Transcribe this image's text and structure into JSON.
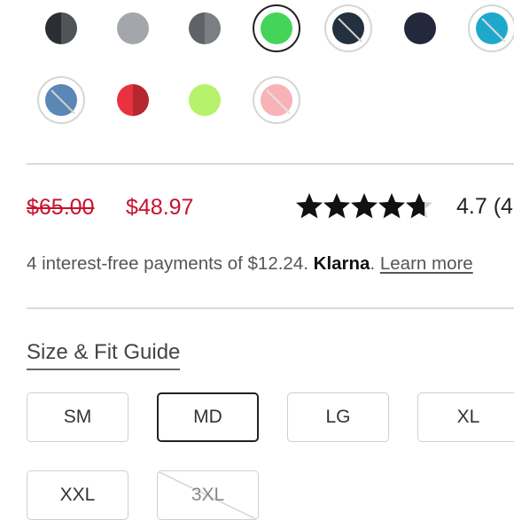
{
  "colors": {
    "price_red": "#c8102e",
    "star_fill": "#111111",
    "swatches_row1": [
      "#2b2f33",
      "#a3a7ab",
      "#5f6368",
      "#45d45a",
      "#22303f",
      "#23283d",
      "#1ea8cc"
    ],
    "swatches_row2": [
      "#5a87b5",
      "#e8323f",
      "#b6f26b",
      "#f7b3b6"
    ]
  },
  "swatch_states": {
    "selected_index": 3,
    "row1_unavailable": [
      4,
      6
    ],
    "row2_unavailable": [
      0,
      3
    ]
  },
  "price": {
    "original": "$65.00",
    "sale": "$48.97"
  },
  "rating": {
    "stars": 4.7,
    "text": "4.7 (4"
  },
  "payments": {
    "text": "4 interest-free payments of $12.24.",
    "provider": "Klarna",
    "period": ".",
    "link": "Learn more"
  },
  "size_guide": {
    "label": "Size & Fit Guide"
  },
  "sizes": [
    "SM",
    "MD",
    "LG",
    "XL",
    "XXL",
    "3XL"
  ],
  "size_states": {
    "selected": "MD",
    "unavailable": [
      "3XL"
    ]
  }
}
